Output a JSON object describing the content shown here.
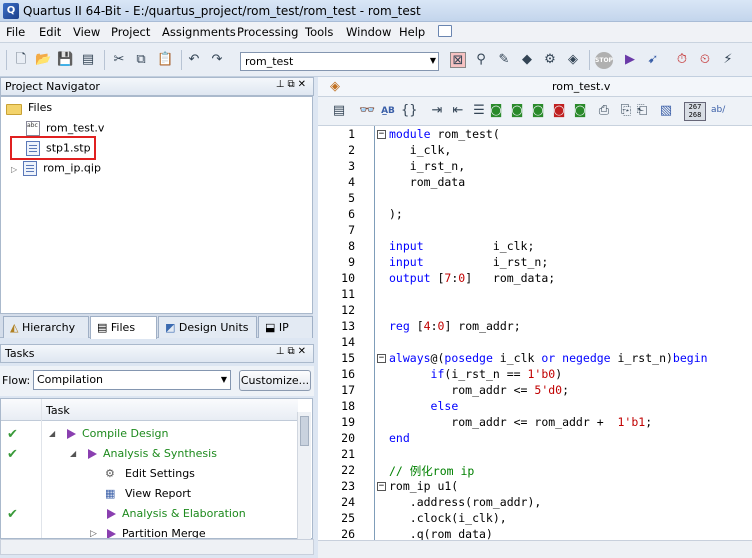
{
  "window": {
    "title": "Quartus II 64-Bit - E:/quartus_project/rom_test/rom_test - rom_test"
  },
  "menu": [
    "File",
    "Edit",
    "View",
    "Project",
    "Assignments",
    "Processing",
    "Tools",
    "Window",
    "Help"
  ],
  "toolbar": {
    "project_select": "rom_test",
    "stop_label": "STOP"
  },
  "project_navigator": {
    "title": "Project Navigator",
    "files_root": "Files",
    "files": [
      "rom_test.v",
      "stp1.stp",
      "rom_ip.qip"
    ],
    "vfile_badge": "abc",
    "tabs": [
      "Hierarchy",
      "Files",
      "Design Units",
      "IP"
    ]
  },
  "tasks": {
    "title": "Tasks",
    "flow_label": "Flow:",
    "flow_value": "Compilation",
    "customize_label": "Customize...",
    "column_header": "Task",
    "rows": [
      {
        "label": "Compile Design",
        "done": true
      },
      {
        "label": "Analysis & Synthesis",
        "done": true
      },
      {
        "label": "Edit Settings",
        "done": false
      },
      {
        "label": "View Report",
        "done": false
      },
      {
        "label": "Analysis & Elaboration",
        "done": true
      },
      {
        "label": "Partition Merge",
        "done": false
      }
    ]
  },
  "editor": {
    "file_tab": "rom_test.v",
    "line_col_badge": "267\n268",
    "ab_label": "ab/",
    "line_numbers": [
      "1",
      "2",
      "3",
      "4",
      "5",
      "6",
      "7",
      "8",
      "9",
      "10",
      "11",
      "12",
      "13",
      "14",
      "15",
      "16",
      "17",
      "18",
      "19",
      "20",
      "21",
      "22",
      "23",
      "24",
      "25",
      "26"
    ],
    "lines": [
      [
        {
          "t": "module",
          "c": "kw"
        },
        {
          "t": " rom_test(",
          "c": "op"
        }
      ],
      [
        {
          "t": "   i_clk,",
          "c": "op"
        }
      ],
      [
        {
          "t": "   i_rst_n,",
          "c": "op"
        }
      ],
      [
        {
          "t": "   rom_data",
          "c": "op"
        }
      ],
      [],
      [
        {
          "t": ");",
          "c": "op"
        }
      ],
      [],
      [
        {
          "t": "input",
          "c": "kw"
        },
        {
          "t": "          i_clk;",
          "c": "op"
        }
      ],
      [
        {
          "t": "input",
          "c": "kw"
        },
        {
          "t": "          i_rst_n;",
          "c": "op"
        }
      ],
      [
        {
          "t": "output",
          "c": "kw"
        },
        {
          "t": " [",
          "c": "op"
        },
        {
          "t": "7",
          "c": "num"
        },
        {
          "t": ":",
          "c": "op"
        },
        {
          "t": "0",
          "c": "num"
        },
        {
          "t": "]   rom_data;",
          "c": "op"
        }
      ],
      [],
      [],
      [
        {
          "t": "reg",
          "c": "kw"
        },
        {
          "t": " [",
          "c": "op"
        },
        {
          "t": "4",
          "c": "num"
        },
        {
          "t": ":",
          "c": "op"
        },
        {
          "t": "0",
          "c": "num"
        },
        {
          "t": "] rom_addr;",
          "c": "op"
        }
      ],
      [],
      [
        {
          "t": "always",
          "c": "kw"
        },
        {
          "t": "@(",
          "c": "op"
        },
        {
          "t": "posedge",
          "c": "kw"
        },
        {
          "t": " i_clk ",
          "c": "op"
        },
        {
          "t": "or",
          "c": "kw"
        },
        {
          "t": " ",
          "c": "op"
        },
        {
          "t": "negedge",
          "c": "kw"
        },
        {
          "t": " i_rst_n)",
          "c": "op"
        },
        {
          "t": "begin",
          "c": "kw"
        }
      ],
      [
        {
          "t": "      ",
          "c": "op"
        },
        {
          "t": "if",
          "c": "kw"
        },
        {
          "t": "(i_rst_n == ",
          "c": "op"
        },
        {
          "t": "1'b0",
          "c": "num"
        },
        {
          "t": ")",
          "c": "op"
        }
      ],
      [
        {
          "t": "         rom_addr <= ",
          "c": "op"
        },
        {
          "t": "5'd0",
          "c": "num"
        },
        {
          "t": ";",
          "c": "op"
        }
      ],
      [
        {
          "t": "      ",
          "c": "op"
        },
        {
          "t": "else",
          "c": "kw"
        }
      ],
      [
        {
          "t": "         rom_addr <= rom_addr +  ",
          "c": "op"
        },
        {
          "t": "1'b1",
          "c": "num"
        },
        {
          "t": ";",
          "c": "op"
        }
      ],
      [
        {
          "t": "end",
          "c": "kw"
        }
      ],
      [],
      [
        {
          "t": "// 例化rom ip",
          "c": "cm"
        }
      ],
      [
        {
          "t": "rom_ip u1(",
          "c": "op"
        }
      ],
      [
        {
          "t": "   .address(rom_addr),",
          "c": "op"
        }
      ],
      [
        {
          "t": "   .clock(i_clk),",
          "c": "op"
        }
      ],
      [
        {
          "t": "   .q(rom_data)",
          "c": "op"
        }
      ]
    ]
  },
  "colors": {
    "keyword": "#0000ff",
    "number": "#c00000",
    "comment": "#008000",
    "highlight": "#e02020",
    "check": "#3a9a3a"
  }
}
